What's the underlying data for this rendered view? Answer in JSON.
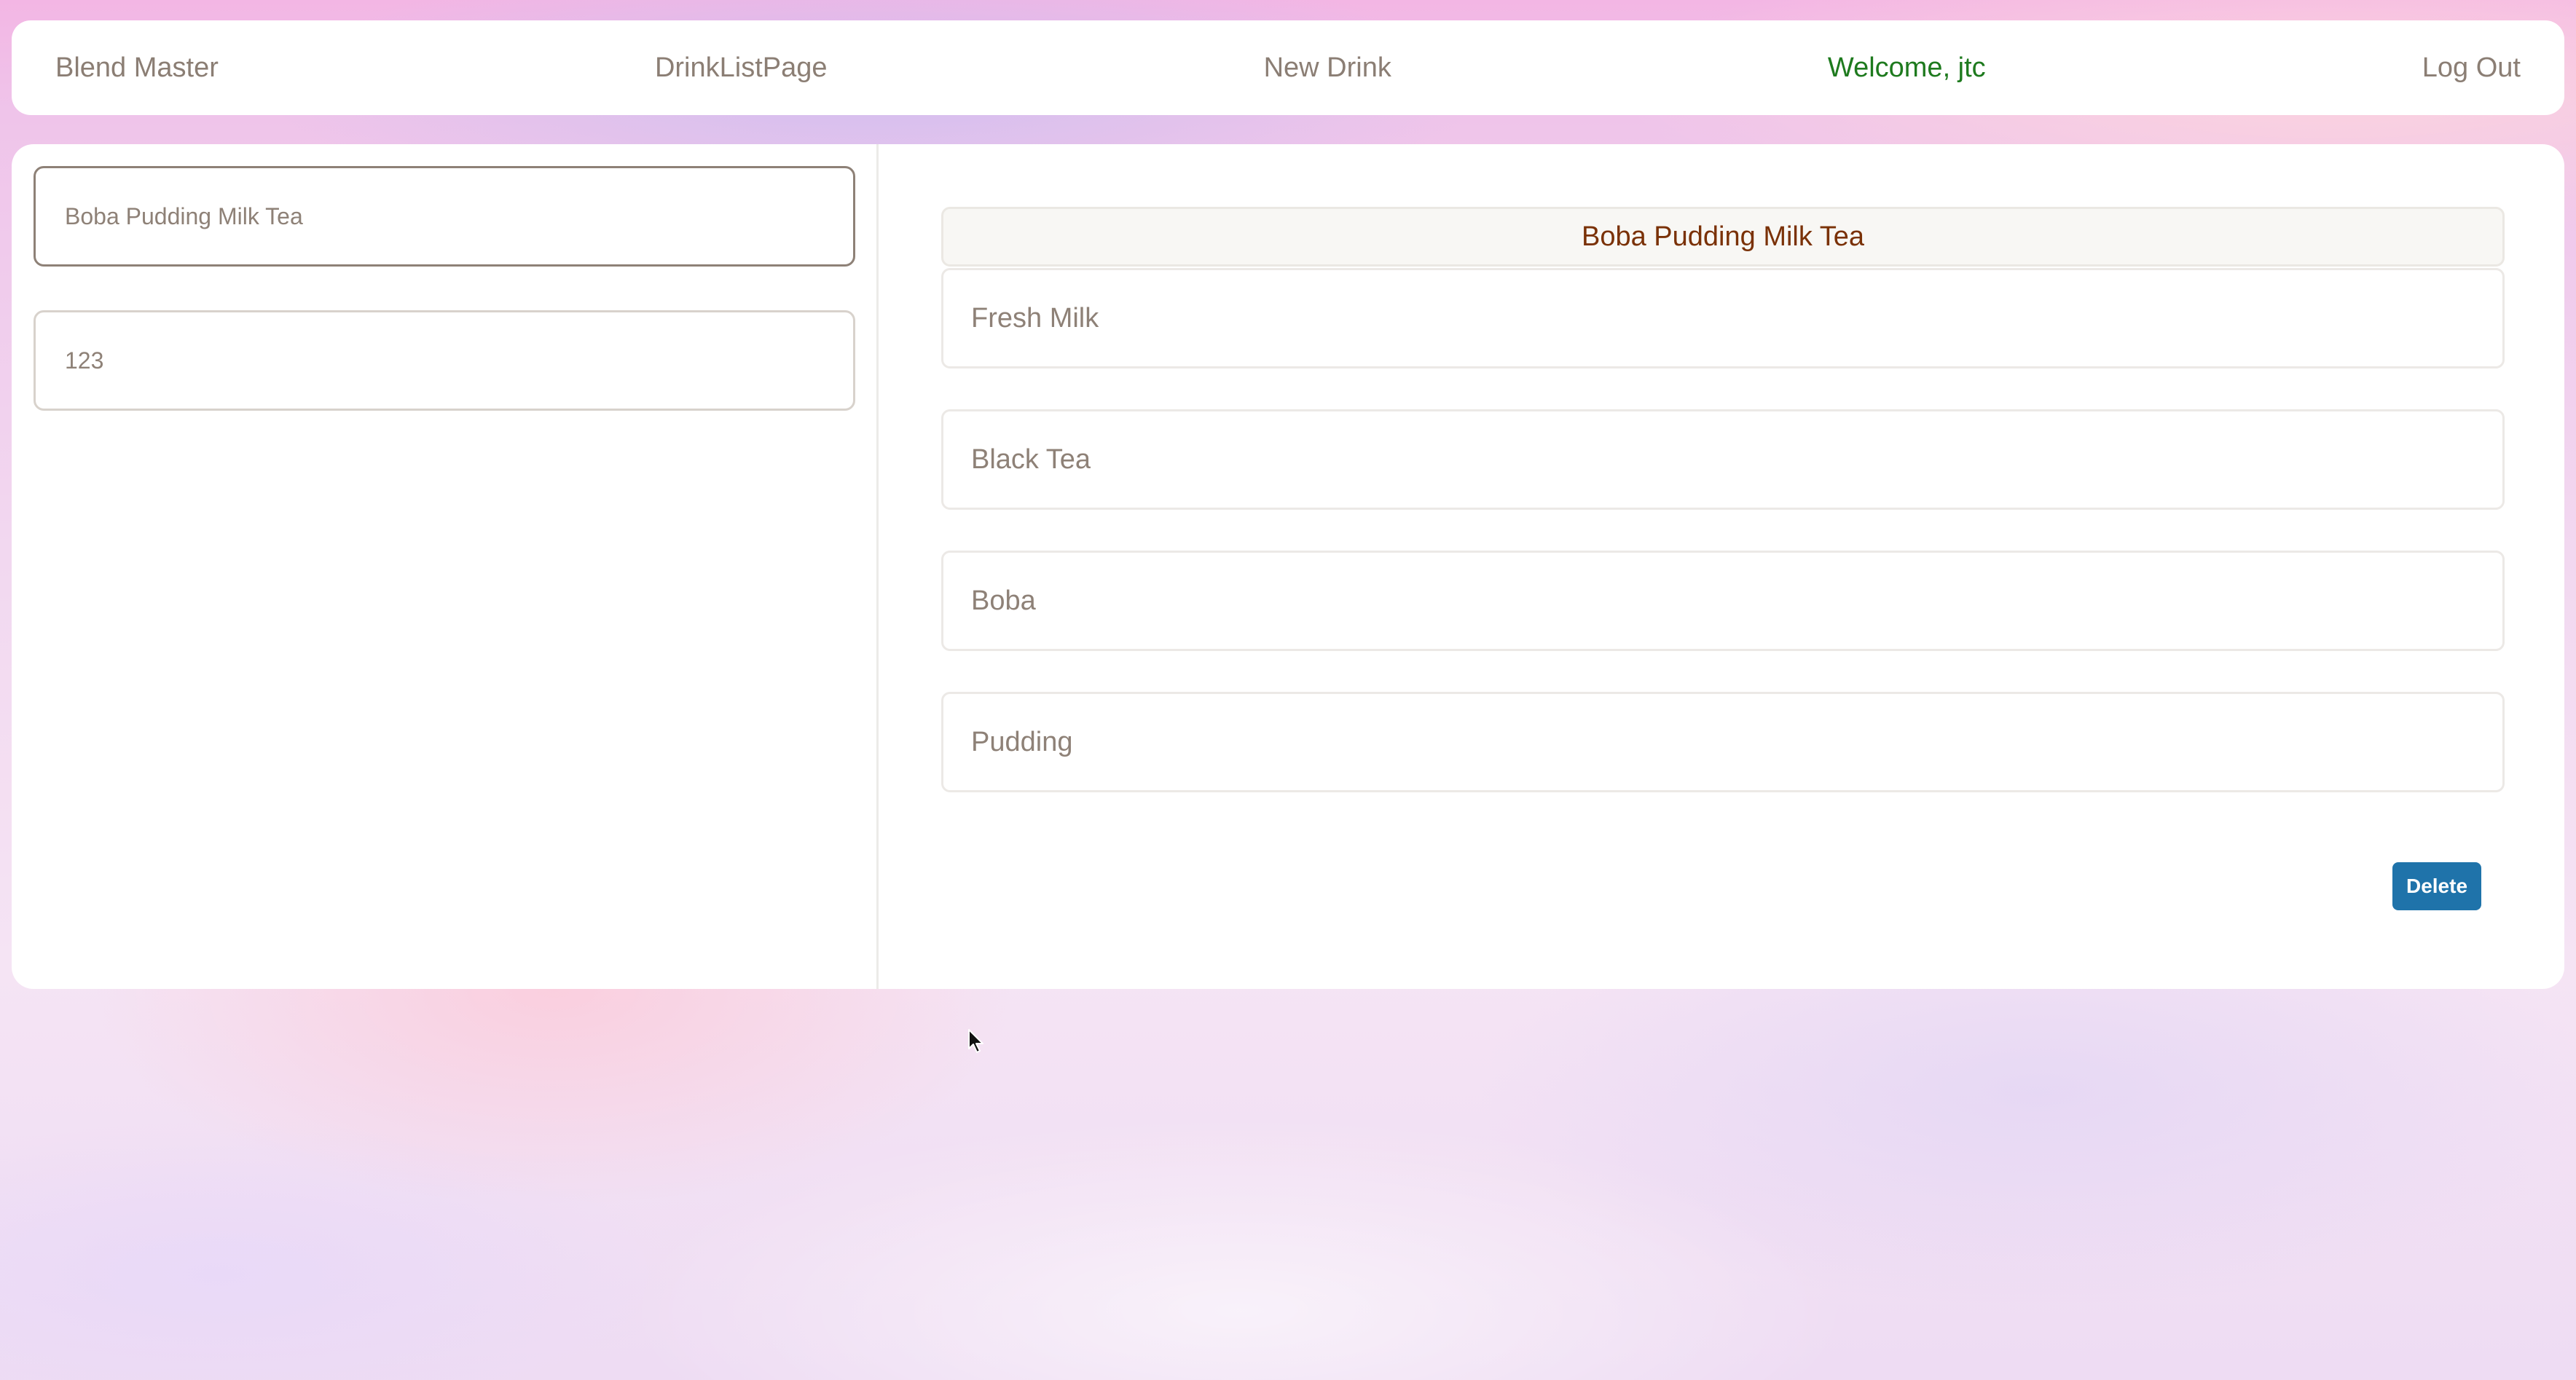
{
  "navbar": {
    "brand": "Blend Master",
    "drink_list": "DrinkListPage",
    "new_drink": "New Drink",
    "welcome": "Welcome, jtc",
    "logout": "Log Out"
  },
  "form": {
    "name_value": "Boba Pudding Milk Tea",
    "code_value": "123"
  },
  "detail": {
    "title": "Boba Pudding Milk Tea",
    "ingredients": [
      "Fresh Milk",
      "Black Tea",
      "Boba",
      "Pudding"
    ],
    "delete_label": "Delete"
  },
  "colors": {
    "accent": "#1f73aa",
    "welcome": "#1e7a1e",
    "title_text": "#7a3106"
  }
}
